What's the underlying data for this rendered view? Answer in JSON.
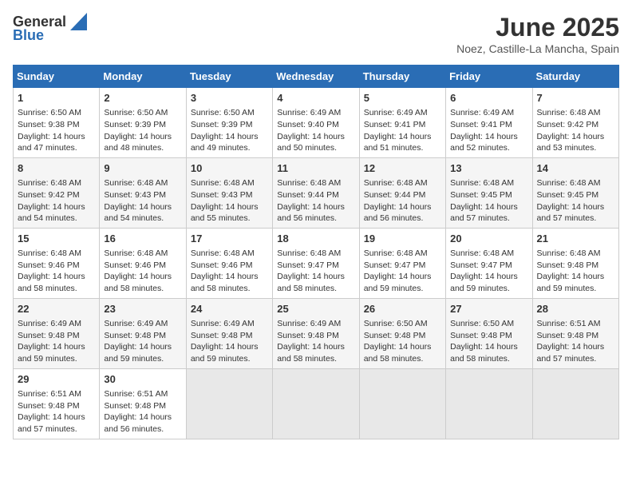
{
  "header": {
    "logo_general": "General",
    "logo_blue": "Blue",
    "title": "June 2025",
    "subtitle": "Noez, Castille-La Mancha, Spain"
  },
  "columns": [
    "Sunday",
    "Monday",
    "Tuesday",
    "Wednesday",
    "Thursday",
    "Friday",
    "Saturday"
  ],
  "weeks": [
    [
      {
        "day": "1",
        "info": "Sunrise: 6:50 AM\nSunset: 9:38 PM\nDaylight: 14 hours\nand 47 minutes."
      },
      {
        "day": "2",
        "info": "Sunrise: 6:50 AM\nSunset: 9:39 PM\nDaylight: 14 hours\nand 48 minutes."
      },
      {
        "day": "3",
        "info": "Sunrise: 6:50 AM\nSunset: 9:39 PM\nDaylight: 14 hours\nand 49 minutes."
      },
      {
        "day": "4",
        "info": "Sunrise: 6:49 AM\nSunset: 9:40 PM\nDaylight: 14 hours\nand 50 minutes."
      },
      {
        "day": "5",
        "info": "Sunrise: 6:49 AM\nSunset: 9:41 PM\nDaylight: 14 hours\nand 51 minutes."
      },
      {
        "day": "6",
        "info": "Sunrise: 6:49 AM\nSunset: 9:41 PM\nDaylight: 14 hours\nand 52 minutes."
      },
      {
        "day": "7",
        "info": "Sunrise: 6:48 AM\nSunset: 9:42 PM\nDaylight: 14 hours\nand 53 minutes."
      }
    ],
    [
      {
        "day": "8",
        "info": "Sunrise: 6:48 AM\nSunset: 9:42 PM\nDaylight: 14 hours\nand 54 minutes."
      },
      {
        "day": "9",
        "info": "Sunrise: 6:48 AM\nSunset: 9:43 PM\nDaylight: 14 hours\nand 54 minutes."
      },
      {
        "day": "10",
        "info": "Sunrise: 6:48 AM\nSunset: 9:43 PM\nDaylight: 14 hours\nand 55 minutes."
      },
      {
        "day": "11",
        "info": "Sunrise: 6:48 AM\nSunset: 9:44 PM\nDaylight: 14 hours\nand 56 minutes."
      },
      {
        "day": "12",
        "info": "Sunrise: 6:48 AM\nSunset: 9:44 PM\nDaylight: 14 hours\nand 56 minutes."
      },
      {
        "day": "13",
        "info": "Sunrise: 6:48 AM\nSunset: 9:45 PM\nDaylight: 14 hours\nand 57 minutes."
      },
      {
        "day": "14",
        "info": "Sunrise: 6:48 AM\nSunset: 9:45 PM\nDaylight: 14 hours\nand 57 minutes."
      }
    ],
    [
      {
        "day": "15",
        "info": "Sunrise: 6:48 AM\nSunset: 9:46 PM\nDaylight: 14 hours\nand 58 minutes."
      },
      {
        "day": "16",
        "info": "Sunrise: 6:48 AM\nSunset: 9:46 PM\nDaylight: 14 hours\nand 58 minutes."
      },
      {
        "day": "17",
        "info": "Sunrise: 6:48 AM\nSunset: 9:46 PM\nDaylight: 14 hours\nand 58 minutes."
      },
      {
        "day": "18",
        "info": "Sunrise: 6:48 AM\nSunset: 9:47 PM\nDaylight: 14 hours\nand 58 minutes."
      },
      {
        "day": "19",
        "info": "Sunrise: 6:48 AM\nSunset: 9:47 PM\nDaylight: 14 hours\nand 59 minutes."
      },
      {
        "day": "20",
        "info": "Sunrise: 6:48 AM\nSunset: 9:47 PM\nDaylight: 14 hours\nand 59 minutes."
      },
      {
        "day": "21",
        "info": "Sunrise: 6:48 AM\nSunset: 9:48 PM\nDaylight: 14 hours\nand 59 minutes."
      }
    ],
    [
      {
        "day": "22",
        "info": "Sunrise: 6:49 AM\nSunset: 9:48 PM\nDaylight: 14 hours\nand 59 minutes."
      },
      {
        "day": "23",
        "info": "Sunrise: 6:49 AM\nSunset: 9:48 PM\nDaylight: 14 hours\nand 59 minutes."
      },
      {
        "day": "24",
        "info": "Sunrise: 6:49 AM\nSunset: 9:48 PM\nDaylight: 14 hours\nand 59 minutes."
      },
      {
        "day": "25",
        "info": "Sunrise: 6:49 AM\nSunset: 9:48 PM\nDaylight: 14 hours\nand 58 minutes."
      },
      {
        "day": "26",
        "info": "Sunrise: 6:50 AM\nSunset: 9:48 PM\nDaylight: 14 hours\nand 58 minutes."
      },
      {
        "day": "27",
        "info": "Sunrise: 6:50 AM\nSunset: 9:48 PM\nDaylight: 14 hours\nand 58 minutes."
      },
      {
        "day": "28",
        "info": "Sunrise: 6:51 AM\nSunset: 9:48 PM\nDaylight: 14 hours\nand 57 minutes."
      }
    ],
    [
      {
        "day": "29",
        "info": "Sunrise: 6:51 AM\nSunset: 9:48 PM\nDaylight: 14 hours\nand 57 minutes."
      },
      {
        "day": "30",
        "info": "Sunrise: 6:51 AM\nSunset: 9:48 PM\nDaylight: 14 hours\nand 56 minutes."
      },
      {
        "day": "",
        "info": ""
      },
      {
        "day": "",
        "info": ""
      },
      {
        "day": "",
        "info": ""
      },
      {
        "day": "",
        "info": ""
      },
      {
        "day": "",
        "info": ""
      }
    ]
  ]
}
